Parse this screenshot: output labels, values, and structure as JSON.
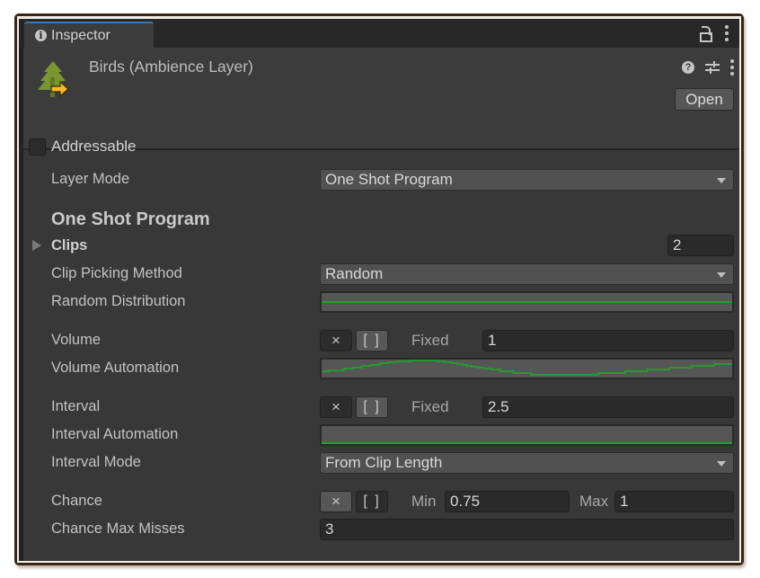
{
  "tab": {
    "label": "Inspector",
    "icon": "info-icon"
  },
  "tab_tools": [
    "lock-icon",
    "kebab-menu-icon"
  ],
  "header": {
    "title": "Birds (Ambience Layer)",
    "asset_icon": "tree-with-arrow-icon",
    "tools": [
      "help-icon",
      "settings-sliders-icon",
      "kebab-menu-icon"
    ],
    "open_label": "Open",
    "addressable_label": "Addressable",
    "addressable_checked": false
  },
  "fields": {
    "layer_mode": {
      "label": "Layer Mode",
      "value": "One Shot Program"
    },
    "section_title": "One Shot Program",
    "clips": {
      "label": "Clips",
      "count": "2",
      "expanded": false
    },
    "clip_picking": {
      "label": "Clip Picking Method",
      "value": "Random"
    },
    "random_distribution": {
      "label": "Random Distribution",
      "curve": "flat"
    },
    "volume": {
      "label": "Volume",
      "x_label": "×",
      "range_label": "[ ]",
      "mode": "Fixed",
      "value": "1"
    },
    "volume_automation": {
      "label": "Volume Automation",
      "curve": "sine-wave"
    },
    "interval": {
      "label": "Interval",
      "x_label": "×",
      "range_label": "[ ]",
      "mode": "Fixed",
      "value": "2.5"
    },
    "interval_automation": {
      "label": "Interval Automation",
      "curve": "flat-bottom"
    },
    "interval_mode": {
      "label": "Interval Mode",
      "value": "From Clip Length"
    },
    "chance": {
      "label": "Chance",
      "x_label": "×",
      "range_label": "[ ]",
      "min_label": "Min",
      "min": "0.75",
      "max_label": "Max",
      "max": "1"
    },
    "chance_max_misses": {
      "label": "Chance Max Misses",
      "value": "3"
    }
  },
  "colors": {
    "curve": "#1fa22a",
    "tab_accent": "#3a79bb",
    "panel": "#383838"
  }
}
